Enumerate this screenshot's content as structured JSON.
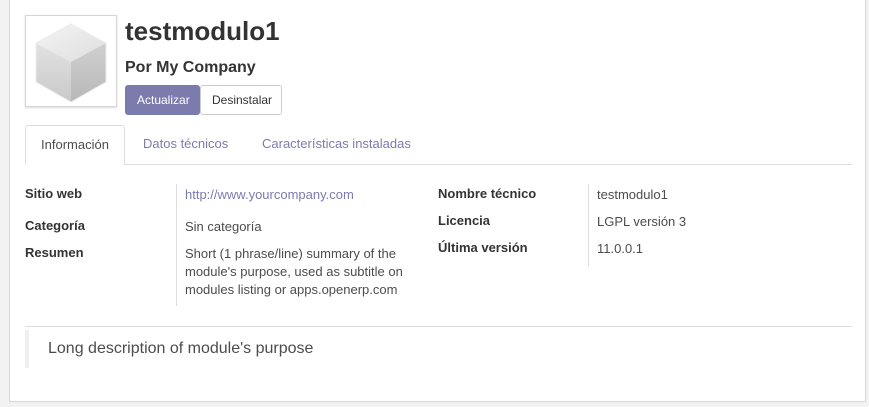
{
  "module": {
    "name": "testmodulo1",
    "author": "Por My Company",
    "icon": "module-cube-icon"
  },
  "actions": {
    "update_label": "Actualizar",
    "uninstall_label": "Desinstalar"
  },
  "tabs": [
    {
      "label": "Información",
      "active": true
    },
    {
      "label": "Datos técnicos",
      "active": false
    },
    {
      "label": "Características instaladas",
      "active": false
    }
  ],
  "info": {
    "left": [
      {
        "label": "Sitio web",
        "value": "http://www.yourcompany.com"
      },
      {
        "label": "Categoría",
        "value": "Sin categoría"
      },
      {
        "label": "Resumen",
        "value": "Short (1 phrase/line) summary of the module's purpose, used as subtitle on modules listing or apps.openerp.com"
      }
    ],
    "right": [
      {
        "label": "Nombre técnico",
        "value": "testmodulo1"
      },
      {
        "label": "Licencia",
        "value": "LGPL versión 3"
      },
      {
        "label": "Última versión",
        "value": "11.0.0.1"
      }
    ]
  },
  "description": "Long description of module's purpose",
  "colors": {
    "primary": "#7c7bad",
    "text": "#4c4c4c",
    "heading": "#333333",
    "border": "#dddddd"
  }
}
